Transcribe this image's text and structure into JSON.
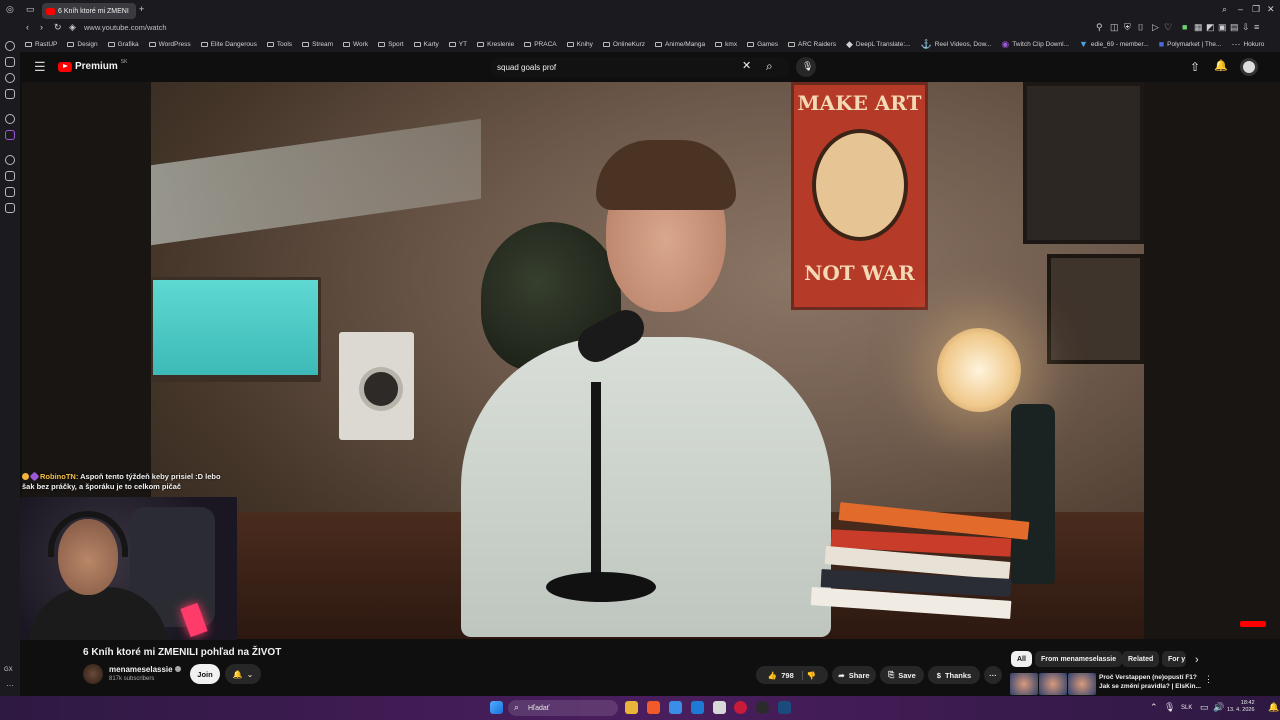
{
  "browser": {
    "tab_title": "6 Kníh ktoré mi ZMENI",
    "url": "www.youtube.com/watch",
    "bookmarks": [
      "RastUP",
      "Design",
      "Grafika",
      "WordPress",
      "Elite Dangerous",
      "Tools",
      "Stream",
      "Work",
      "Sport",
      "Karty",
      "YT",
      "Kreslenie",
      "PRACA",
      "Knihy",
      "OnlineKurz",
      "Anime/Manga",
      "kmx",
      "Games",
      "ARC Raiders",
      "DeepL Translate:...",
      "Reel Videos, Dow...",
      "Twitch Clip Downl...",
      "edie_69 - member...",
      "Polymarket | The...",
      "Hokuro"
    ]
  },
  "youtube": {
    "logo_text": "Premium",
    "region": "SK",
    "search_value": "squad goals prof"
  },
  "overlay": {
    "chat_user": "RobinoTN:",
    "chat_line1": "Aspoň tento týždeň keby prisiel :D lebo",
    "chat_line2": "šak bez práčky, a šporáku je to celkom pičač"
  },
  "poster": {
    "line1": "MAKE ART",
    "line2": "NOT WAR"
  },
  "video_info": {
    "title": "6 Kníh ktoré mi ZMENILI pohľad na ŽIVOT",
    "channel": "menameselassie",
    "subscribers": "817k subscribers",
    "join_label": "Join",
    "likes": "798",
    "share_label": "Share",
    "save_label": "Save",
    "thanks_label": "Thanks"
  },
  "filter_chips": [
    "All",
    "From menameselassie",
    "Related",
    "For y"
  ],
  "recommendation": {
    "title_line1": "Proč Verstappen (ne)opustí F1?",
    "title_line2": "Jak se změní pravidla? | ElsKin..."
  },
  "taskbar": {
    "search_placeholder": "Hľadať",
    "lang": "SLK",
    "time": "18:42",
    "date": "13. 4. 2026"
  },
  "colors": {
    "youtube_red": "#ff0000",
    "taskbar": "#3c1c50"
  }
}
